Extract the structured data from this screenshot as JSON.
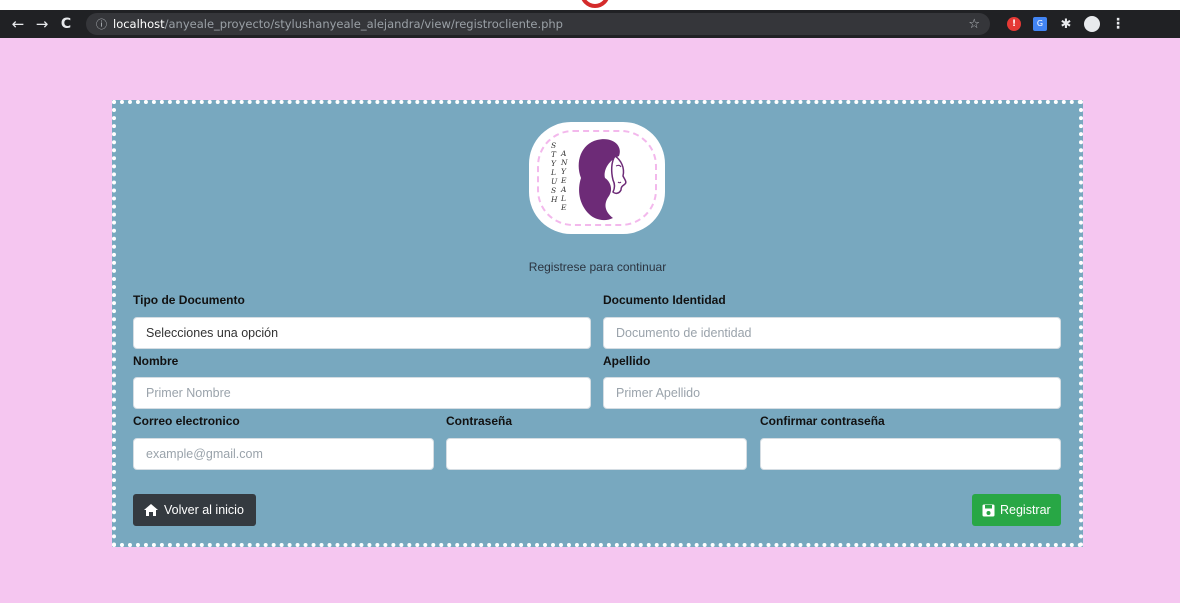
{
  "browser": {
    "back_glyph": "←",
    "forward_glyph": "→",
    "reload_glyph": "C",
    "info_glyph": "ⓘ",
    "url_host": "localhost",
    "url_path": "/anyeale_proyecto/stylushanyeale_alejandra/view/registrocliente.php",
    "star_glyph": "☆",
    "menu_glyph": "⋮"
  },
  "logo": {
    "text_column_1": "STYLUSH",
    "text_column_2": "ANYEALE",
    "accent_color": "#6d2b77"
  },
  "form": {
    "subtitle": "Registrese para continuar",
    "fields": {
      "tipo_documento": {
        "label": "Tipo de Documento",
        "value": "Selecciones una opción"
      },
      "documento_identidad": {
        "label": "Documento Identidad",
        "placeholder": "Documento de identidad"
      },
      "nombre": {
        "label": "Nombre",
        "placeholder": "Primer Nombre"
      },
      "apellido": {
        "label": "Apellido",
        "placeholder": "Primer Apellido"
      },
      "correo": {
        "label": "Correo electronico",
        "placeholder": "example@gmail.com"
      },
      "contrasena": {
        "label": "Contraseña",
        "placeholder": ""
      },
      "confirmar": {
        "label": "Confirmar contraseña",
        "placeholder": ""
      }
    },
    "buttons": {
      "volver": "Volver al inicio",
      "registrar": "Registrar"
    }
  },
  "colors": {
    "page_bg": "#f5c6f0",
    "card_bg": "#78a8bf",
    "btn_dark": "#343a40",
    "btn_success": "#28a745"
  }
}
